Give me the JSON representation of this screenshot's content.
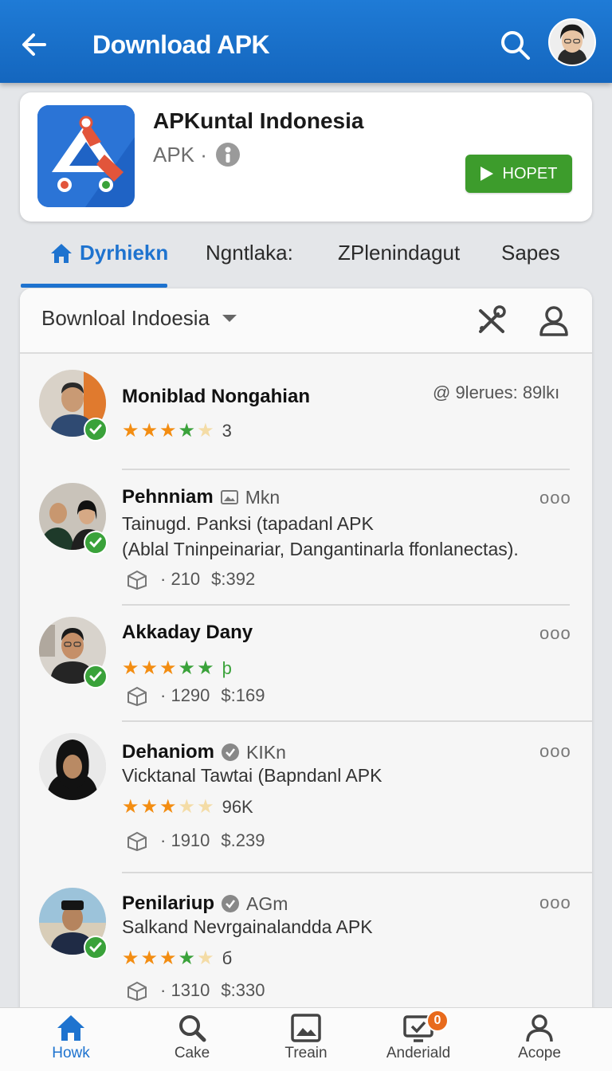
{
  "header": {
    "title": "Download APK",
    "icons": {
      "back": "arrow-left-icon",
      "search": "search-icon",
      "avatar": "user-avatar"
    },
    "bar_color": "#1a6fcb"
  },
  "app": {
    "name": "APKuntal Indonesia",
    "subtitle": "APK ·",
    "button_label": "HOPET",
    "button_color": "#3d9c2c"
  },
  "tabs": [
    {
      "label": "Dyrhiekn",
      "active": true
    },
    {
      "label": "Ngntlaka:"
    },
    {
      "label": "ZPlenindagut"
    },
    {
      "label": "Sapes"
    }
  ],
  "panel": {
    "filter_label": "Bownloal Indoesia",
    "stats": "@ 9lerues: 89lkı"
  },
  "entries": [
    {
      "name": "Moniblad Nongahian",
      "rating_text": "3"
    },
    {
      "name": "Pehnniam",
      "tag": "Mkn",
      "line1": "Tainugd. Panksi (tapadanl APK",
      "line2": "(Ablal Tninpeinariar, Dangantinarla ffonlanectas).",
      "count": "210",
      "price": "$:392",
      "more": "ooo"
    },
    {
      "name": "Akkaday Dany",
      "rating_text": "þ",
      "count": "1290",
      "price": "$:169",
      "more": "ooo"
    },
    {
      "name": "Dehaniom",
      "tag": "KIKn",
      "line1": "Vicktanal Tawtai (Bapndanl APK",
      "rating_text": "96K",
      "count": "1910",
      "price": "$.239",
      "more": "ooo"
    },
    {
      "name": "Penilariup",
      "tag": "AGm",
      "line1": "Salkand Nevrgainalandda APK",
      "rating_text": "б",
      "count": "1310",
      "price": "$:330",
      "more": "ooo"
    }
  ],
  "bottom_nav": [
    {
      "label": "Howk",
      "icon": "home-icon",
      "active": true
    },
    {
      "label": "Cake",
      "icon": "search-icon"
    },
    {
      "label": "Treain",
      "icon": "image-icon"
    },
    {
      "label": "Anderiald",
      "icon": "monitor-check-icon",
      "badge": "0"
    },
    {
      "label": "Acope",
      "icon": "person-icon"
    }
  ]
}
